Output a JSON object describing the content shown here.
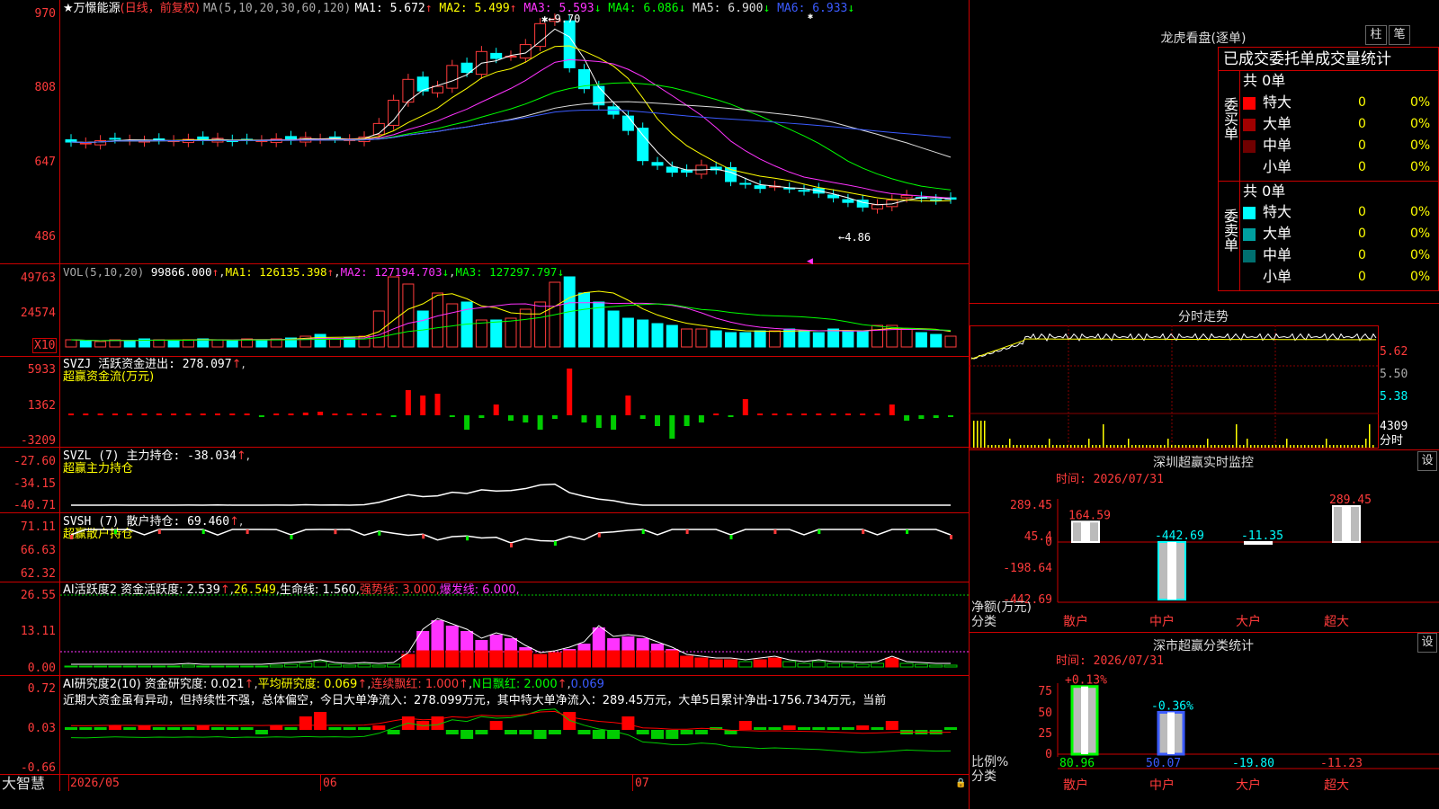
{
  "kline": {
    "stock_name": "★万憬能源",
    "period": "(日线，前复权)",
    "ma_title": "MA(5,10,20,30,60,120)",
    "ma": [
      {
        "label": "MA1: 5.672",
        "arrow": "↑",
        "color": "#ffffff"
      },
      {
        "label": "MA2: 5.499",
        "arrow": "↑",
        "color": "#ffff00"
      },
      {
        "label": "MA3: 5.593",
        "arrow": "↓",
        "color": "#ff33ff"
      },
      {
        "label": "MA4: 6.086",
        "arrow": "↓",
        "color": "#00ff00"
      },
      {
        "label": "MA5: 6.900",
        "arrow": "↓",
        "color": "#dddddd"
      },
      {
        "label": "MA6: 6.933",
        "arrow": "↓",
        "color": "#3b5bff"
      }
    ],
    "y_ticks": [
      "970",
      "808",
      "647",
      "486"
    ],
    "high_marker": "9.70",
    "low_marker": "←4.86",
    "star": "✱"
  },
  "vol": {
    "title": "VOL(5,10,20)",
    "value": "99866.000",
    "ma1": "MA1: 126135.398",
    "ma2": "MA2: 127194.703",
    "ma3": "MA3: 127297.797",
    "y_ticks": [
      "49763",
      "24574"
    ],
    "unit": "X10"
  },
  "svzj": {
    "title": "SVZJ  活跃资金进出: 278.097",
    "subtitle": "超赢资金流(万元)",
    "y_ticks": [
      "5933",
      "1362",
      "-3209"
    ]
  },
  "svzl": {
    "title": "SVZL (7) 主力持仓: -38.034",
    "subtitle": "超赢主力持仓",
    "y_ticks": [
      "-27.60",
      "-34.15",
      "-40.71"
    ]
  },
  "svsh": {
    "title": "SVSH (7) 散户持仓: 69.460",
    "subtitle": "超赢散户持仓",
    "y_ticks": [
      "71.11",
      "66.63",
      "62.32"
    ]
  },
  "ai1": {
    "title": "AI活跃度2 资金活跃度: 2.539",
    "v2": "26.549",
    "life": "生命线: 1.560,",
    "strong": "强势线: 3.000,",
    "burst": "爆发线: 6.000,",
    "y_ticks": [
      "26.55",
      "13.11",
      "0.00"
    ]
  },
  "ai2": {
    "title": "AI研究度2(10) 资金研究度: 0.021",
    "avg": "平均研究度: 0.069",
    "cont": "连续飘红: 1.000",
    "nday": "N日飘红: 2.000",
    "last": "0.069",
    "comment": "近期大资金虽有异动，但持续性不强，总体偏空，今日大单净流入：278.099万元，其中特大单净流入：289.45万元，大单5日累计净出-1756.734万元，当前",
    "y_ticks": [
      "0.72",
      "0.03",
      "-0.66"
    ]
  },
  "bottom": {
    "brand": "大智慧",
    "dates": [
      "2026/05",
      "06",
      "07"
    ]
  },
  "lhb": {
    "title": "龙虎看盘(逐单)",
    "btn1": "柱",
    "btn2": "笔",
    "header": "已成交委托单成交量统计",
    "buy_side": "委买单",
    "sell_side": "委卖单",
    "buy_total": "共 0单",
    "sell_total": "共 0单",
    "rows_buy": [
      {
        "name": "特大",
        "count": "0",
        "pct": "0%",
        "color": "#ff0000"
      },
      {
        "name": "大单",
        "count": "0",
        "pct": "0%",
        "color": "#a00000"
      },
      {
        "name": "中单",
        "count": "0",
        "pct": "0%",
        "color": "#700000"
      },
      {
        "name": "小单",
        "count": "0",
        "pct": "0%",
        "color": "#000000"
      }
    ],
    "rows_sell": [
      {
        "name": "特大",
        "count": "0",
        "pct": "0%",
        "color": "#00ffff"
      },
      {
        "name": "大单",
        "count": "0",
        "pct": "0%",
        "color": "#00a0a0"
      },
      {
        "name": "中单",
        "count": "0",
        "pct": "0%",
        "color": "#007070"
      },
      {
        "name": "小单",
        "count": "0",
        "pct": "0%",
        "color": "#000000"
      }
    ]
  },
  "intraday": {
    "title": "分时走势",
    "y_ticks": [
      "5.62",
      "5.50",
      "5.38"
    ],
    "vol_label": "4309",
    "vol_unit": "分时"
  },
  "sz_monitor": {
    "title": "深圳超赢实时监控",
    "btn": "设",
    "time": "时间: 2026/07/31",
    "y_ticks": [
      "289.45",
      "45.4",
      "0",
      "-198.64",
      "-442.69"
    ],
    "y_label": "净额(万元)",
    "x_label": "分类",
    "categories": [
      "散户",
      "中户",
      "大户",
      "超大"
    ],
    "values": [
      "164.59",
      "-442.69",
      "-11.35",
      "289.45"
    ]
  },
  "sz_stats": {
    "title": "深市超赢分类统计",
    "btn": "设",
    "time": "时间: 2026/07/31",
    "y_ticks": [
      "75",
      "50",
      "25",
      "0"
    ],
    "y_label": "比例%",
    "x_label": "分类",
    "categories": [
      "散户",
      "中户",
      "大户",
      "超大"
    ],
    "top_labels": [
      "+0.13%",
      "-0.36%"
    ],
    "values": [
      "80.96",
      "50.07",
      "-19.80",
      "-11.23"
    ]
  }
}
